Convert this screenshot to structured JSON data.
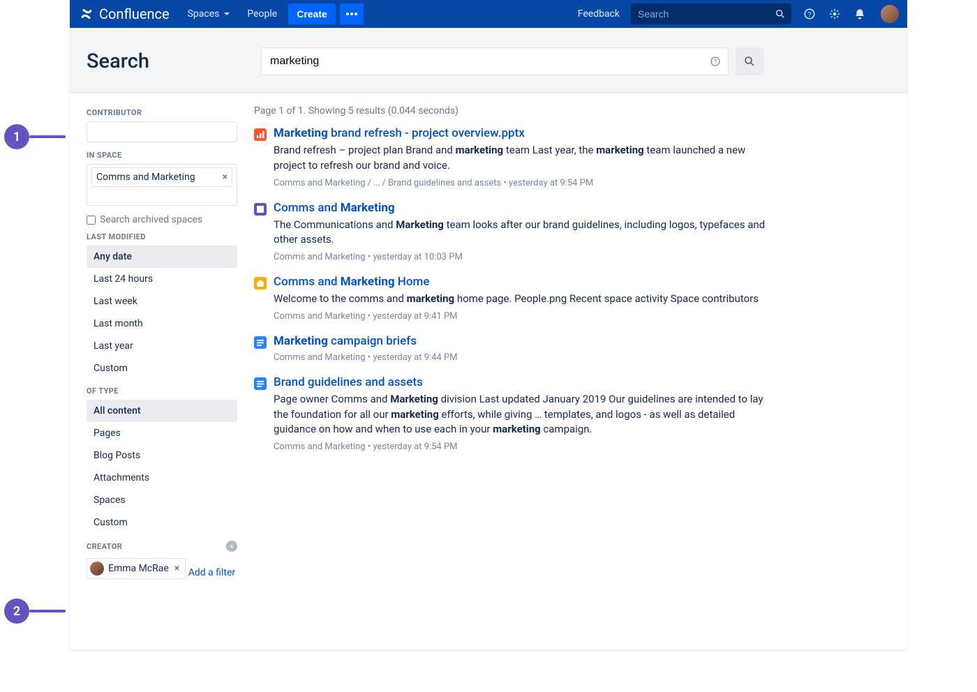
{
  "topbar": {
    "brand": "Confluence",
    "spaces": "Spaces",
    "people": "People",
    "create": "Create",
    "feedback": "Feedback",
    "search_placeholder": "Search"
  },
  "search": {
    "heading": "Search",
    "query": "marketing"
  },
  "filters": {
    "contributor_label": "CONTRIBUTOR",
    "in_space_label": "IN SPACE",
    "space_chip": "Comms and Marketing",
    "archived_label": "Search archived spaces",
    "last_modified_label": "LAST MODIFIED",
    "last_modified_options": [
      "Any date",
      "Last 24 hours",
      "Last week",
      "Last month",
      "Last year",
      "Custom"
    ],
    "last_modified_selected": 0,
    "of_type_label": "OF TYPE",
    "of_type_options": [
      "All content",
      "Pages",
      "Blog Posts",
      "Attachments",
      "Spaces",
      "Custom"
    ],
    "of_type_selected": 0,
    "creator_label": "CREATOR",
    "creator_name": "Emma McRae",
    "add_filter": "Add a filter"
  },
  "results": {
    "meta": "Page 1 of 1. Showing 5 results (0.044 seconds)",
    "items": [
      {
        "icon": "pptx",
        "title_html": "<b>Marketing</b> brand refresh - project overview.pptx",
        "snippet_html": "Brand refresh – project plan Brand and <b>marketing</b> team Last year, the <b>marketing</b> team launched a new project to refresh our brand and voice.",
        "path": "Comms and Marketing / … / Brand guidelines and assets • yesterday at 9:54 PM"
      },
      {
        "icon": "space",
        "title_html": "Comms and <b>Marketing</b>",
        "snippet_html": "The Communications and <b>Marketing</b> team looks after our brand guidelines, including logos, typefaces and other assets.",
        "path": "Comms and Marketing • yesterday at 10:03 PM"
      },
      {
        "icon": "home",
        "title_html": "Comms and <b>Marketing</b> Home",
        "snippet_html": "Welcome to the comms and <b>marketing</b> home page. People.png Recent space activity Space contributors",
        "path": "Comms and Marketing • yesterday at 9:41 PM"
      },
      {
        "icon": "page",
        "title_html": "<b>Marketing</b> campaign briefs",
        "snippet_html": "",
        "path": "Comms and Marketing • yesterday at 9:44 PM"
      },
      {
        "icon": "page",
        "title_html": "Brand guidelines and assets",
        "snippet_html": "Page owner Comms and <b>Marketing</b> division Last updated January 2019 Our guidelines are intended to lay the foundation for all our <b>marketing</b> efforts, while giving … templates, and logos - as well as detailed guidance on how and when to use each in your <b>marketing</b> campaign.",
        "path": "Comms and Marketing • yesterday at 9:54 PM"
      }
    ]
  },
  "annotations": {
    "one": "1",
    "two": "2"
  }
}
